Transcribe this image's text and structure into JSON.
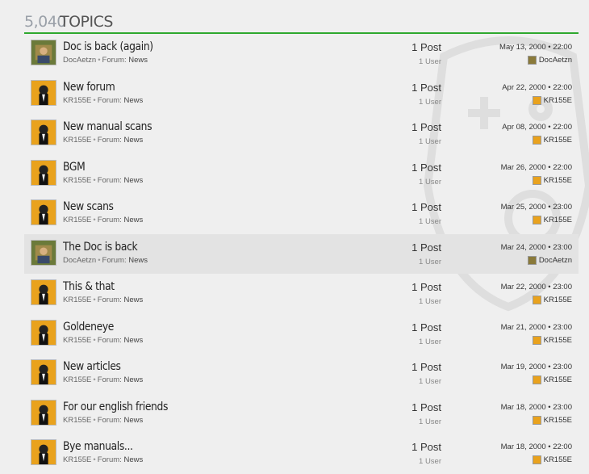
{
  "header": {
    "count": "5,040",
    "label": "TOPICS"
  },
  "topics": [
    {
      "title": "Doc is back (again)",
      "author": "DocAetzn",
      "forum_prefix": "Forum:",
      "forum": "News",
      "posts": "1 Post",
      "users": "1 User",
      "date": "May 13, 2000 • 22:00",
      "last_user": "DocAetzn",
      "avatar": "doc-avatar"
    },
    {
      "title": "New forum",
      "author": "KR155E",
      "forum_prefix": "Forum:",
      "forum": "News",
      "posts": "1 Post",
      "users": "1 User",
      "date": "Apr 22, 2000 • 22:00",
      "last_user": "KR155E",
      "avatar": "kr-avatar"
    },
    {
      "title": "New manual scans",
      "author": "KR155E",
      "forum_prefix": "Forum:",
      "forum": "News",
      "posts": "1 Post",
      "users": "1 User",
      "date": "Apr 08, 2000 • 22:00",
      "last_user": "KR155E",
      "avatar": "kr-avatar"
    },
    {
      "title": "BGM",
      "author": "KR155E",
      "forum_prefix": "Forum:",
      "forum": "News",
      "posts": "1 Post",
      "users": "1 User",
      "date": "Mar 26, 2000 • 22:00",
      "last_user": "KR155E",
      "avatar": "kr-avatar"
    },
    {
      "title": "New scans",
      "author": "KR155E",
      "forum_prefix": "Forum:",
      "forum": "News",
      "posts": "1 Post",
      "users": "1 User",
      "date": "Mar 25, 2000 • 23:00",
      "last_user": "KR155E",
      "avatar": "kr-avatar"
    },
    {
      "title": "The Doc is back",
      "author": "DocAetzn",
      "forum_prefix": "Forum:",
      "forum": "News",
      "posts": "1 Post",
      "users": "1 User",
      "date": "Mar 24, 2000 • 23:00",
      "last_user": "DocAetzn",
      "avatar": "doc-avatar"
    },
    {
      "title": "This & that",
      "author": "KR155E",
      "forum_prefix": "Forum:",
      "forum": "News",
      "posts": "1 Post",
      "users": "1 User",
      "date": "Mar 22, 2000 • 23:00",
      "last_user": "KR155E",
      "avatar": "kr-avatar"
    },
    {
      "title": "Goldeneye",
      "author": "KR155E",
      "forum_prefix": "Forum:",
      "forum": "News",
      "posts": "1 Post",
      "users": "1 User",
      "date": "Mar 21, 2000 • 23:00",
      "last_user": "KR155E",
      "avatar": "kr-avatar"
    },
    {
      "title": "New articles",
      "author": "KR155E",
      "forum_prefix": "Forum:",
      "forum": "News",
      "posts": "1 Post",
      "users": "1 User",
      "date": "Mar 19, 2000 • 23:00",
      "last_user": "KR155E",
      "avatar": "kr-avatar"
    },
    {
      "title": "For our english friends",
      "author": "KR155E",
      "forum_prefix": "Forum:",
      "forum": "News",
      "posts": "1 Post",
      "users": "1 User",
      "date": "Mar 18, 2000 • 23:00",
      "last_user": "KR155E",
      "avatar": "kr-avatar"
    },
    {
      "title": "Bye manuals...",
      "author": "KR155E",
      "forum_prefix": "Forum:",
      "forum": "News",
      "posts": "1 Post",
      "users": "1 User",
      "date": "Mar 18, 2000 • 22:00",
      "last_user": "KR155E",
      "avatar": "kr-avatar"
    }
  ],
  "colors": {
    "accent": "#2ea82e",
    "highlight_row": "#e3e3e3"
  }
}
